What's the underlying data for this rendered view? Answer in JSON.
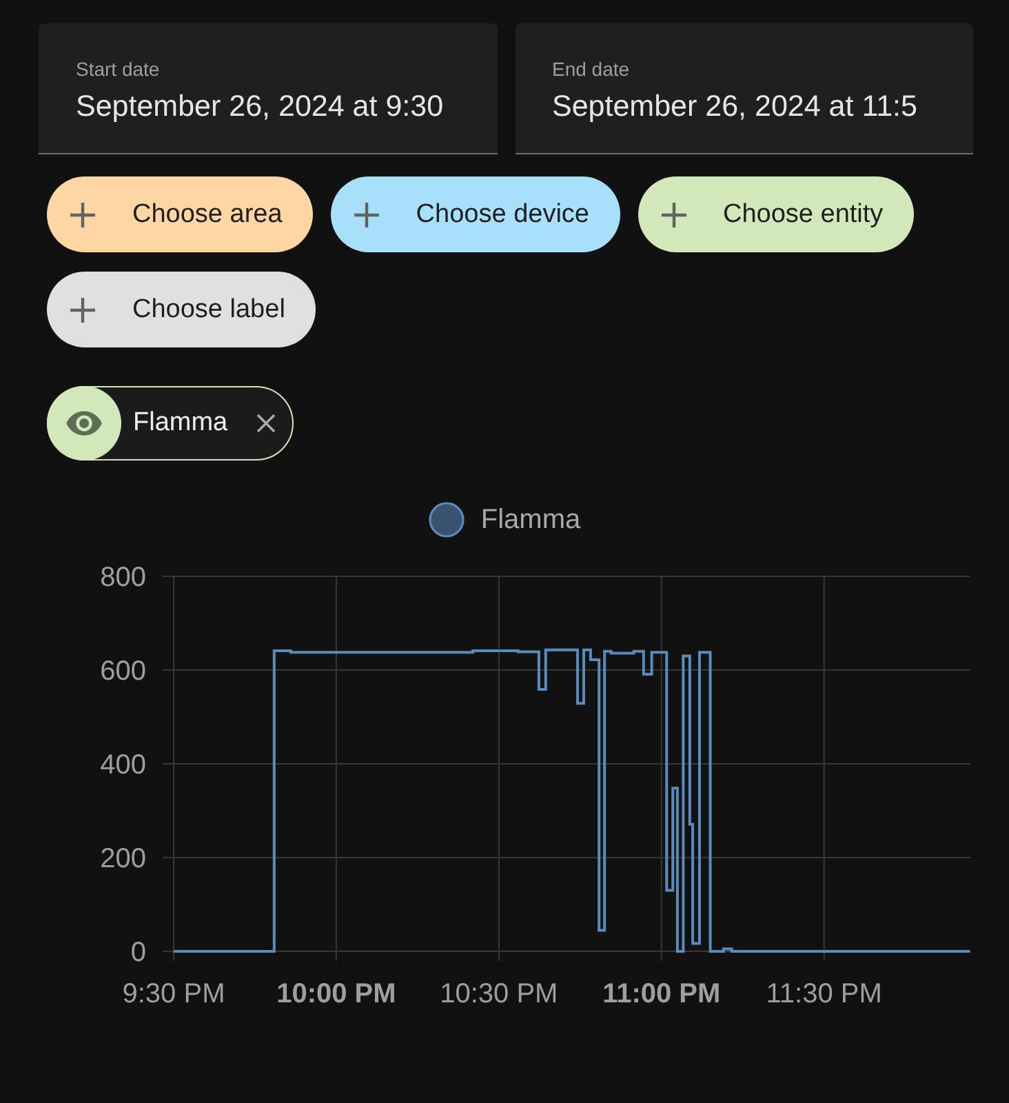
{
  "date_range": [
    {
      "label": "Start date",
      "value": "September 26, 2024 at 9:30"
    },
    {
      "label": "End date",
      "value": "September 26, 2024 at 11:5"
    }
  ],
  "pickers": [
    {
      "label": "Choose area",
      "color": "#fed6a4"
    },
    {
      "label": "Choose device",
      "color": "#a8e0fb"
    },
    {
      "label": "Choose entity",
      "color": "#d2e8ba"
    },
    {
      "label": "Choose label",
      "color": "#e0e0e0"
    }
  ],
  "targets": [
    {
      "name": "Flamma",
      "color": "#d2e8ba"
    }
  ],
  "history": {
    "chart_data": {
      "type": "line",
      "grid": true,
      "x": [
        21.5,
        21.809,
        21.809,
        21.86,
        21.86,
        22.42,
        22.42,
        22.559,
        22.559,
        22.623,
        22.623,
        22.644,
        22.644,
        22.742,
        22.742,
        22.761,
        22.761,
        22.782,
        22.782,
        22.808,
        22.808,
        22.825,
        22.825,
        22.845,
        22.845,
        22.915,
        22.915,
        22.945,
        22.945,
        22.97,
        22.97,
        23.016,
        23.016,
        23.035,
        23.035,
        23.049,
        23.049,
        23.067,
        23.067,
        23.087,
        23.087,
        23.096,
        23.096,
        23.117,
        23.117,
        23.15,
        23.15,
        23.191,
        23.191,
        23.216,
        23.216,
        23.949
      ],
      "series": [
        {
          "name": "Flamma",
          "color": "#5b8bbd",
          "values": [
            0,
            0,
            641,
            641,
            638,
            638,
            641,
            641,
            639,
            639,
            559,
            559,
            643,
            643,
            529,
            529,
            643,
            643,
            622,
            622,
            45,
            45,
            640,
            640,
            636,
            636,
            640,
            640,
            591,
            591,
            638,
            638,
            130,
            130,
            348,
            348,
            0,
            0,
            630,
            630,
            271,
            271,
            17,
            17,
            638,
            638,
            0,
            0,
            5,
            5,
            0,
            0
          ]
        }
      ],
      "xlim": [
        21.5,
        23.95
      ],
      "ylim": [
        0,
        800
      ],
      "xticks": [
        {
          "value": 21.5,
          "label": "9:30 PM"
        },
        {
          "value": 22,
          "label": "10:00 PM"
        },
        {
          "value": 22.5,
          "label": "10:30 PM"
        },
        {
          "value": 23,
          "label": "11:00 PM"
        },
        {
          "value": 23.5,
          "label": "11:30 PM"
        }
      ],
      "yticks": [
        0,
        200,
        400,
        600,
        800
      ]
    }
  }
}
